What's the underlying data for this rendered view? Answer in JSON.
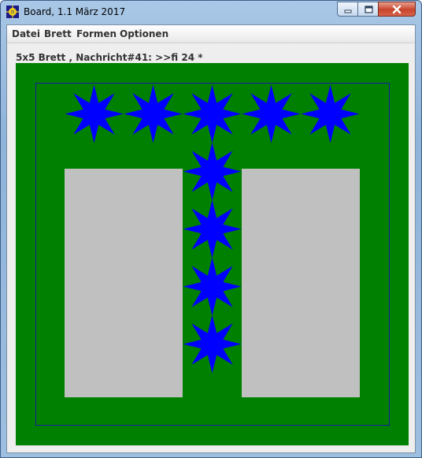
{
  "window": {
    "title": "Board, 1.1 März 2017"
  },
  "menu": {
    "items": [
      {
        "label": "Datei",
        "id": "datei"
      },
      {
        "label": "Brett",
        "id": "brett"
      },
      {
        "label": "Formen",
        "id": "formen"
      },
      {
        "label": "Optionen",
        "id": "optionen"
      }
    ]
  },
  "status": {
    "text": "5x5 Brett , Nachricht#41: >>fi 24 *"
  },
  "board": {
    "size": "5x5",
    "colors": {
      "background": "#008000",
      "frame": "#1a1aa0",
      "star": "#0000ff",
      "field_gray": "#c0c0c0"
    },
    "cells": [
      {
        "row": 0,
        "col": 0,
        "shape": "star8",
        "color": "#0000ff"
      },
      {
        "row": 0,
        "col": 1,
        "shape": "star8",
        "color": "#0000ff"
      },
      {
        "row": 0,
        "col": 2,
        "shape": "star8",
        "color": "#0000ff"
      },
      {
        "row": 0,
        "col": 3,
        "shape": "star8",
        "color": "#0000ff"
      },
      {
        "row": 0,
        "col": 4,
        "shape": "star8",
        "color": "#0000ff"
      },
      {
        "row": 1,
        "col": 2,
        "shape": "star8",
        "color": "#0000ff"
      },
      {
        "row": 2,
        "col": 2,
        "shape": "star8",
        "color": "#0000ff"
      },
      {
        "row": 3,
        "col": 2,
        "shape": "star8",
        "color": "#0000ff"
      },
      {
        "row": 4,
        "col": 2,
        "shape": "star8",
        "color": "#0000ff"
      }
    ],
    "gray_blocks": [
      {
        "row_start": 1,
        "row_end": 4,
        "col_start": 0,
        "col_end": 1
      },
      {
        "row_start": 1,
        "row_end": 4,
        "col_start": 3,
        "col_end": 4
      }
    ]
  },
  "icons": {
    "app": "board-app-icon",
    "minimize": "minimize-icon",
    "maximize": "maximize-icon",
    "close": "close-icon"
  }
}
